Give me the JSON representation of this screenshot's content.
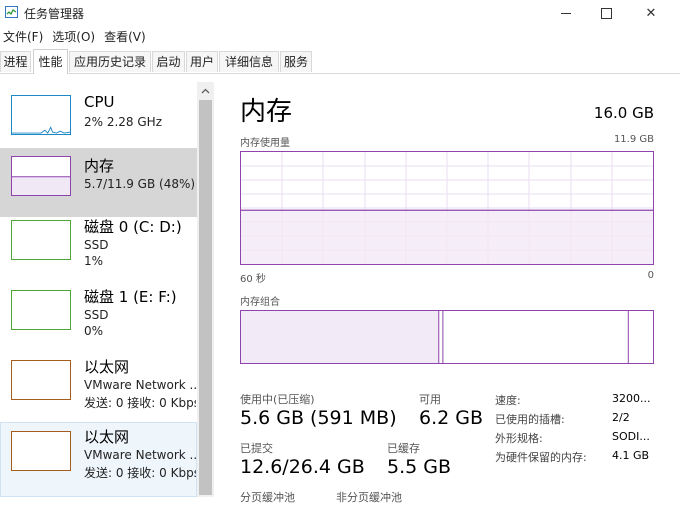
{
  "window": {
    "title": "任务管理器",
    "icon": "task-manager-icon",
    "controls": {
      "minimize": "—",
      "maximize": "☐",
      "close": "✕"
    }
  },
  "menu": [
    "文件(F)",
    "选项(O)",
    "查看(V)"
  ],
  "tabs": [
    "进程",
    "性能",
    "应用历史记录",
    "启动",
    "用户",
    "详细信息",
    "服务"
  ],
  "active_tab": "性能",
  "sidebar": [
    {
      "title": "CPU",
      "line1": "2% 2.28 GHz",
      "line2": "",
      "color": "#1e88c7",
      "state": "normal"
    },
    {
      "title": "内存",
      "line1": "5.7/11.9 GB (48%)",
      "line2": "",
      "color": "#8e44ad",
      "state": "selected",
      "fill_fraction": 0.48
    },
    {
      "title": "磁盘 0 (C: D:)",
      "line1": "SSD",
      "line2": "1%",
      "color": "#4da736",
      "state": "normal"
    },
    {
      "title": "磁盘 1 (E: F:)",
      "line1": "SSD",
      "line2": "0%",
      "color": "#4da736",
      "state": "normal"
    },
    {
      "title": "以太网",
      "line1": "VMware Network ...",
      "line2": "发送: 0 接收: 0 Kbps",
      "color": "#a65c1c",
      "state": "normal"
    },
    {
      "title": "以太网",
      "line1": "VMware Network ...",
      "line2": "发送: 0 接收: 0 Kbps",
      "color": "#a65c1c",
      "state": "hovered"
    }
  ],
  "main": {
    "title": "内存",
    "total": "16.0 GB",
    "usage_label": "内存使用量",
    "usage_max": "11.9 GB",
    "usage_fraction": 0.48,
    "time_left": "60 秒",
    "time_right": "0",
    "composition_label": "内存组合",
    "composition": {
      "in_use_fraction": 0.48,
      "modified_fraction": 0.01,
      "standby_fraction": 0.45
    },
    "stats": {
      "in_use_label": "使用中(已压缩)",
      "in_use_value": "5.6 GB (591 MB)",
      "available_label": "可用",
      "available_value": "6.2 GB",
      "committed_label": "已提交",
      "committed_value": "12.6/26.4 GB",
      "cached_label": "已缓存",
      "cached_value": "5.5 GB",
      "paged_label": "分页缓冲池",
      "nonpaged_label": "非分页缓冲池"
    },
    "details": [
      {
        "key": "速度:",
        "value": "3200..."
      },
      {
        "key": "已使用的插槽:",
        "value": "2/2"
      },
      {
        "key": "外形规格:",
        "value": "SODI..."
      },
      {
        "key": "为硬件保留的内存:",
        "value": "4.1 GB"
      }
    ]
  }
}
